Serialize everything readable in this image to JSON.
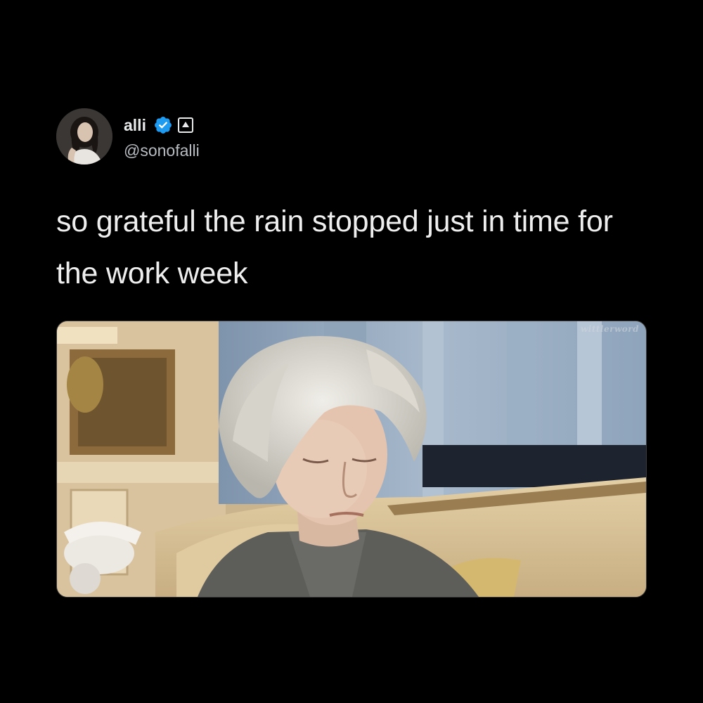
{
  "tweet": {
    "author": {
      "display_name": "alli",
      "handle": "@sonofalli",
      "verified": true,
      "verified_color": "#1d9bf0",
      "avatar_icon": "avatar-photo",
      "badge_icon": "affiliate-badge-icon"
    },
    "text": "so grateful the rain stopped just in time for the work week",
    "media": {
      "type": "gif-still",
      "watermark": "wittlerword"
    }
  },
  "colors": {
    "background": "#000000",
    "text": "#eeeeee",
    "handle": "#b8bdc2"
  }
}
